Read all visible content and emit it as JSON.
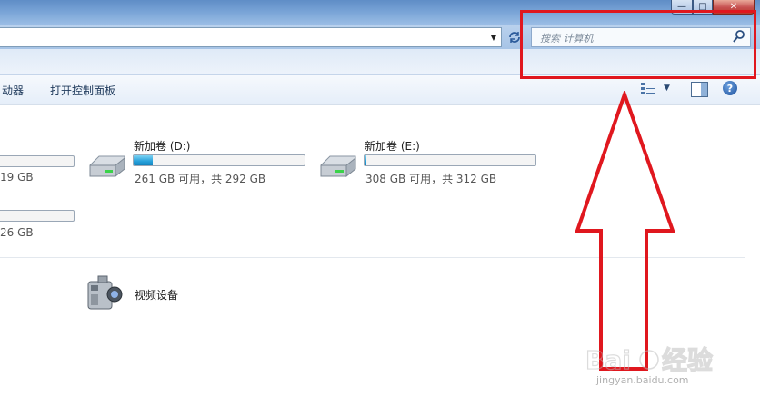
{
  "window": {
    "caption_buttons": {
      "minimize": "—",
      "maximize": "□",
      "close": "✕"
    }
  },
  "address_bar": {
    "dropdown_icon": "chevron-down-icon",
    "refresh_icon": "refresh-icon"
  },
  "search": {
    "placeholder": "搜索 计算机",
    "icon": "magnifier-icon"
  },
  "command_bar": {
    "partial_item": "动器",
    "open_control_panel": "打开控制面板",
    "icons": [
      "view-options-icon",
      "preview-pane-icon",
      "help-icon"
    ]
  },
  "drives": [
    {
      "name": "",
      "info": "19 GB",
      "used_fraction": 0.0
    },
    {
      "name": "新加卷 (D:)",
      "info": "261 GB 可用，共 292 GB",
      "used_fraction": 0.11
    },
    {
      "name": "新加卷 (E:)",
      "info": "308 GB 可用，共 312 GB",
      "used_fraction": 0.01
    },
    {
      "name": "",
      "info": "26 GB",
      "used_fraction": 0.0
    }
  ],
  "devices": [
    {
      "name": "视频设备",
      "icon": "video-camera-icon"
    }
  ],
  "annotation": {
    "color": "#e0171e"
  },
  "watermark": {
    "brand": "Baidu经验",
    "url": "jingyan.baidu.com"
  }
}
